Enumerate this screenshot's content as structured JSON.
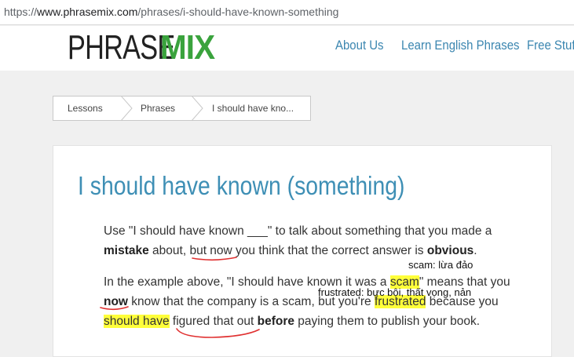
{
  "browser": {
    "url_scheme": "https://",
    "url_host": "www.phrasemix.com",
    "url_path": "/phrases/i-should-have-known-something"
  },
  "header": {
    "logo_phrase": "PHRASE",
    "logo_mix": "MIX",
    "nav": [
      "About Us",
      "Learn English Phrases",
      "Free Stuff"
    ]
  },
  "breadcrumb": [
    "Lessons",
    "Phrases",
    "I should have kno..."
  ],
  "article": {
    "title": "I should have known (something)",
    "para1": {
      "line1": "Use \"I should have known ___\" to talk about something that you made a",
      "l2_mistake": "mistake",
      "l2_a": " about, ",
      "l2_butnow": "but now",
      "l2_b": " you think that the correct answer is ",
      "l2_obvious": "obvious",
      "l2_c": "."
    },
    "para2": {
      "l1_a": "In the example above, \"I should have known it was a ",
      "l1_scam": "scam",
      "l1_b": "\" means that you",
      "l2_now": "now",
      "l2_a": " know that the company is a scam, but you're ",
      "l2_frustrated": "frustrated",
      "l2_b": " because you",
      "l3_shouldhave": "should have",
      "l3_a": " figured that out ",
      "l3_before": "before",
      "l3_b": " paying them to publish your book."
    },
    "notes": {
      "scam": "scam: lừa đảo",
      "frustrated": "frustrated: bực bội, thất vọng, nản"
    }
  },
  "colors": {
    "accent": "#3e8fb5",
    "logo_green": "#3aa33d",
    "highlight": "#ffff3a",
    "annotation": "#e03030"
  }
}
